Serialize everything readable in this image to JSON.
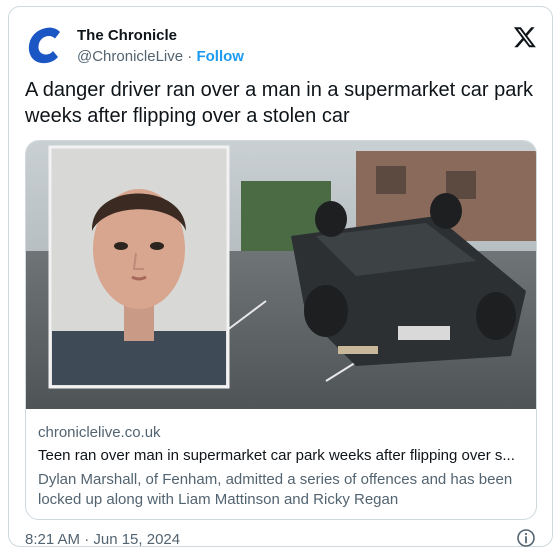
{
  "author": {
    "name": "The Chronicle",
    "handle": "@ChronicleLive",
    "separator": " · ",
    "follow_label": "Follow",
    "brand_color": "#1a56c4"
  },
  "tweet": {
    "text": "A danger driver ran over a man in a supermarket car park weeks after flipping over a stolen car"
  },
  "link_card": {
    "domain": "chroniclelive.co.uk",
    "title": "Teen ran over man in supermarket car park weeks after flipping over s...",
    "description": "Dylan Marshall, of Fenham, admitted a series of offences and has been locked up along with Liam Mattinson and Ricky Regan",
    "media": {
      "left_image": "mugshot-photo",
      "right_image": "overturned-car-photo"
    }
  },
  "footer": {
    "timestamp": "8:21 AM · Jun 15, 2024",
    "info_icon": "info-icon"
  },
  "icons": {
    "logo": "x-logo-icon"
  }
}
